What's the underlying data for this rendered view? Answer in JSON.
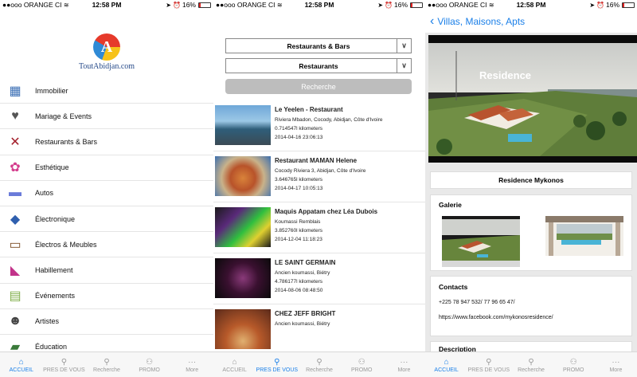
{
  "status": {
    "carrier": "ORANGE CI",
    "time": "12:58 PM",
    "battery": "16%",
    "battery_level": 0.16,
    "signal_dots": "●●ooo"
  },
  "tabs": [
    {
      "label": "ACCUEIL",
      "icon": "home-icon",
      "glyph": "⌂"
    },
    {
      "label": "PRES DE VOUS",
      "icon": "location-pin-icon",
      "glyph": "⚲"
    },
    {
      "label": "Recherche",
      "icon": "search-icon",
      "glyph": "⚲"
    },
    {
      "label": "PROMO",
      "icon": "people-icon",
      "glyph": "⚇"
    },
    {
      "label": "More",
      "icon": "more-dots-icon",
      "glyph": "···"
    }
  ],
  "screen1": {
    "logo_text": "ToutAbidjan.com",
    "logo_letter": "A",
    "categories": [
      {
        "label": "Immobilier",
        "icon": "building-icon",
        "glyph": "▦",
        "color": "#3b6fb5"
      },
      {
        "label": "Mariage & Events",
        "icon": "wedding-couple-icon",
        "glyph": "♥",
        "color": "#555555"
      },
      {
        "label": "Restaurants & Bars",
        "icon": "restaurant-icon",
        "glyph": "✕",
        "color": "#a31f2b"
      },
      {
        "label": "Esthétique",
        "icon": "beauty-icon",
        "glyph": "✿",
        "color": "#d43d8d"
      },
      {
        "label": "Autos",
        "icon": "car-icon",
        "glyph": "▬",
        "color": "#6a7bd9"
      },
      {
        "label": "Électronique",
        "icon": "electronics-icon",
        "glyph": "◆",
        "color": "#2f5fae"
      },
      {
        "label": "Électros & Meubles",
        "icon": "furniture-icon",
        "glyph": "▭",
        "color": "#7a4a22"
      },
      {
        "label": "Habillement",
        "icon": "shoe-icon",
        "glyph": "◣",
        "color": "#c2338a"
      },
      {
        "label": "Événements",
        "icon": "calendar-icon",
        "glyph": "▤",
        "color": "#7fae4a"
      },
      {
        "label": "Artistes",
        "icon": "artist-icon",
        "glyph": "☻",
        "color": "#444444"
      },
      {
        "label": "Éducation",
        "icon": "education-icon",
        "glyph": "▰",
        "color": "#3a7a3a"
      }
    ]
  },
  "screen2": {
    "select1": "Restaurants & Bars",
    "select2": "Restaurants",
    "search_label": "Recherche",
    "results": [
      {
        "name": "Le Yeelen - Restaurant",
        "address": "Riviera Mbadon, Cocody, Abidjan, Côte d'Ivoire",
        "distance": "0.714547l kilometers",
        "date": "2014-04-16 23:06:13",
        "thumb": "linear-gradient(180deg,#6fa7d8 0%,#9cc8e6 40%,#2f5e7a 60%,#3b4b55 100%)"
      },
      {
        "name": "Restaurant MAMAN Helene",
        "address": "Cocody Riviera 3, Abidjan, Côte d'Ivoire",
        "distance": "3.646765l kilometers",
        "date": "2014-04-17 10:05:13",
        "thumb": "radial-gradient(circle at 50% 55%,#d9833a 0%,#b8532a 35%,#c9b28a 60%,#3c6fae 100%)"
      },
      {
        "name": "Maquis Appatam chez Léa Dubois",
        "address": "Koumassi Remblais",
        "distance": "3.852760l kilometers",
        "date": "2014-12-04 11:18:23",
        "thumb": "linear-gradient(135deg,#1a1a1a 0%,#5a2a7a 30%,#2fbf3f 55%,#e0d030 75%,#1a1a1a 100%)"
      },
      {
        "name": "LE SAINT GERMAIN",
        "address": "Ancien koumassi, Biétry",
        "distance": "4.786177l kilometers",
        "date": "2014-08-06 08:48:50",
        "thumb": "radial-gradient(circle at 50% 50%,#8a3a7a 0%,#3a1030 45%,#0a0a0a 100%)"
      },
      {
        "name": "CHEZ JEFF BRIGHT",
        "address": "Ancien koumassi, Biétry",
        "distance": "",
        "date": "",
        "thumb": "radial-gradient(circle at 50% 80%,#e0b070 0%,#b85a2a 40%,#5a2a1a 100%)"
      }
    ]
  },
  "screen3": {
    "back_label": "Villas, Maisons, Apts",
    "hero_title": "Residence",
    "property_name": "Residence Mykonos",
    "gallery_label": "Galerie",
    "contacts_label": "Contacts",
    "phone": "+225 78 947 532/ 77 96 65 47/",
    "website": "https://www.facebook.com/mykonosresidence/",
    "description_label": "Description"
  },
  "active_tabs": [
    "ACCUEIL",
    "PRES DE VOUS",
    "ACCUEIL"
  ]
}
